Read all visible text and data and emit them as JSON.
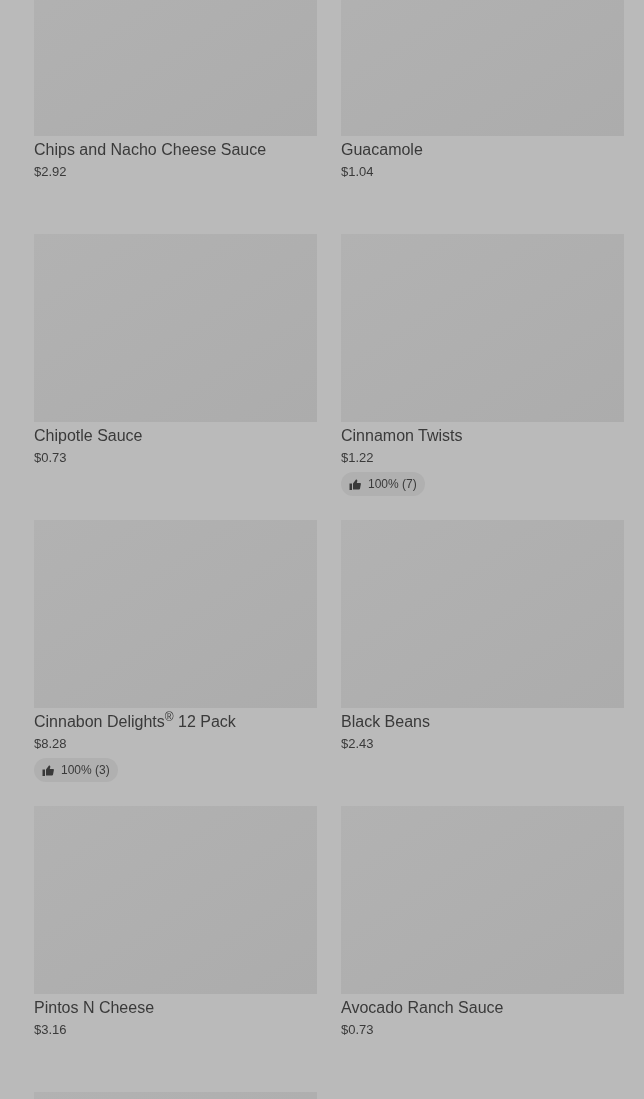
{
  "products": [
    {
      "kind": "product",
      "name": "Chips and Nacho Cheese Sauce",
      "price": "$2.92"
    },
    {
      "kind": "product",
      "name": "Guacamole",
      "price": "$1.04"
    },
    {
      "kind": "product",
      "name": "Chipotle Sauce",
      "price": "$0.73"
    },
    {
      "kind": "product",
      "name": "Cinnamon Twists",
      "price": "$1.22",
      "rating": "100% (7)"
    },
    {
      "kind": "product",
      "name": "Cinnabon Delights$^{®}$ 12 Pack",
      "price": "$8.28",
      "rating": "100% (3)"
    },
    {
      "kind": "product",
      "name": "Black Beans",
      "price": "$2.43"
    },
    {
      "kind": "product",
      "name": "Pintos N Cheese",
      "price": "$3.16"
    },
    {
      "kind": "product",
      "name": "Avocado Ranch Sauce",
      "price": "$0.73"
    },
    {
      "kind": "picture"
    }
  ]
}
